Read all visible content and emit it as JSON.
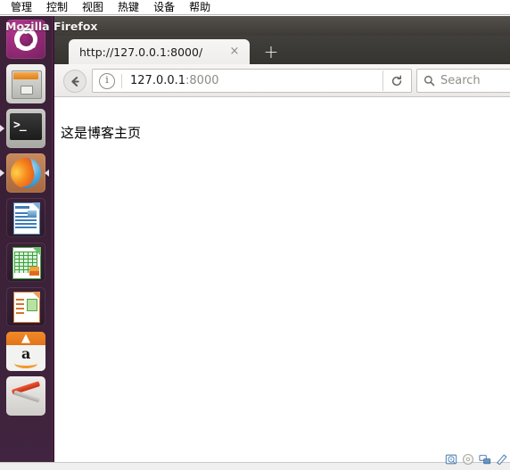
{
  "vbox": {
    "menu": [
      {
        "label": "管理",
        "name": "menu-manage"
      },
      {
        "label": "控制",
        "name": "menu-control"
      },
      {
        "label": "视图",
        "name": "menu-view"
      },
      {
        "label": "热键",
        "name": "menu-hotkeys"
      },
      {
        "label": "设备",
        "name": "menu-devices"
      },
      {
        "label": "帮助",
        "name": "menu-help"
      }
    ],
    "status_icons": [
      {
        "name": "hard-disk-icon"
      },
      {
        "name": "optical-disc-icon"
      },
      {
        "name": "network-adapter-icon"
      },
      {
        "name": "shared-folders-icon"
      }
    ]
  },
  "launcher": {
    "items": [
      {
        "name": "launcher-item-ubuntu-dash",
        "label": "Ubuntu Dash"
      },
      {
        "name": "launcher-item-files",
        "label": "Files"
      },
      {
        "name": "launcher-item-terminal",
        "label": "Terminal",
        "glyph": ">_"
      },
      {
        "name": "launcher-item-firefox",
        "label": "Firefox",
        "running": true
      },
      {
        "name": "launcher-item-libreoffice-writer",
        "label": "LibreOffice Writer"
      },
      {
        "name": "launcher-item-libreoffice-calc",
        "label": "LibreOffice Calc"
      },
      {
        "name": "launcher-item-libreoffice-impress",
        "label": "LibreOffice Impress"
      },
      {
        "name": "launcher-item-amazon",
        "label": "Amazon",
        "glyph": "a"
      },
      {
        "name": "launcher-item-system-tools",
        "label": "System Tools"
      }
    ]
  },
  "firefox": {
    "window_title": "Mozilla Firefox",
    "tab": {
      "title": "http://127.0.0.1:8000/",
      "close_label": "×"
    },
    "newtab_label": "+",
    "toolbar": {
      "back_label": "Back",
      "info_label": "i",
      "url_host": "127.0.0.1",
      "url_port": ":8000",
      "reload_label": "Reload"
    },
    "search": {
      "placeholder": "Search"
    },
    "content": {
      "heading": "这是博客主页"
    }
  },
  "colors": {
    "launcher_bg": "#3b2138",
    "titlebar_dark": "#3e3b36",
    "tabstrip_dark": "#35342f",
    "tab_active": "#f3f2f0",
    "navbar_bg": "#efedeb",
    "content_bg": "#ffffff",
    "status_bg": "#efefef"
  }
}
